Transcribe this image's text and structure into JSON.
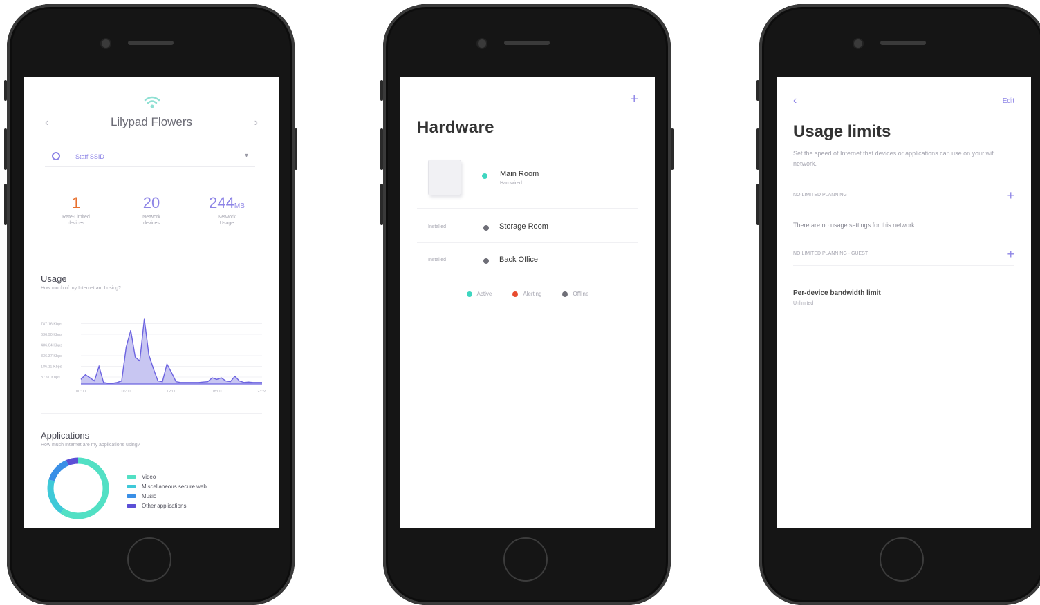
{
  "colors": {
    "accent": "#7b6ee6",
    "orange": "#e8712f",
    "teal": "#3ed6c0",
    "chart_fill": "#c8c6f2",
    "chart_line": "#6c63e0",
    "offline": "#6f6f78",
    "alerting": "#e84c2f"
  },
  "screen1": {
    "title": "Lilypad Flowers",
    "prev_icon": "chevron-left-icon",
    "next_icon": "chevron-right-icon",
    "network_select": {
      "value": "Staff SSID"
    },
    "stats": [
      {
        "value": "1",
        "unit": "",
        "label_line1": "Rate-Limited",
        "label_line2": "devices",
        "color": "#e8712f"
      },
      {
        "value": "20",
        "unit": "",
        "label_line1": "Network",
        "label_line2": "devices",
        "color": "#8d84e6"
      },
      {
        "value": "244",
        "unit": "MB",
        "label_line1": "Network",
        "label_line2": "Usage",
        "color": "#8d84e6"
      }
    ],
    "usage": {
      "title": "Usage",
      "subtitle": "How much of my Internet am I using?"
    },
    "applications": {
      "title": "Applications",
      "subtitle": "How much Internet are my applications using?",
      "legend": [
        {
          "label": "Video",
          "color": "#52e0c4"
        },
        {
          "label": "Miscellaneous secure web",
          "color": "#3fc9d8"
        },
        {
          "label": "Music",
          "color": "#3a8fe6"
        },
        {
          "label": "Other applications",
          "color": "#5b4fd6"
        }
      ]
    }
  },
  "chart_data": {
    "type": "area",
    "title": "",
    "xlabel": "",
    "ylabel": "",
    "y_tick_labels": [
      "37.90 Kbps",
      "186.11 Kbps",
      "336.37 Kbps",
      "486.64 Kbps",
      "636.90 Kbps",
      "787.16 Kbps"
    ],
    "x_tick_labels": [
      "00:00",
      "06:00",
      "12:00",
      "18:00",
      "23:59"
    ],
    "ylim": [
      0,
      900
    ],
    "x": [
      0,
      1,
      2,
      3,
      4,
      5,
      6,
      7,
      8,
      9,
      10,
      11,
      12,
      13,
      14,
      15,
      16,
      17,
      18,
      19,
      20,
      21,
      22,
      23,
      24,
      25,
      26,
      27,
      28,
      29,
      30,
      31,
      32,
      33,
      34,
      35,
      36,
      37,
      38,
      39,
      40
    ],
    "series": [
      {
        "values": [
          60,
          120,
          80,
          40,
          230,
          20,
          10,
          10,
          20,
          40,
          480,
          700,
          350,
          300,
          850,
          380,
          200,
          40,
          30,
          260,
          150,
          30,
          20,
          20,
          20,
          20,
          20,
          25,
          30,
          80,
          60,
          80,
          40,
          30,
          100,
          40,
          20,
          25,
          20,
          20,
          20
        ]
      }
    ]
  },
  "screen2": {
    "title": "Hardware",
    "add_icon": "plus-icon",
    "devices": [
      {
        "name": "Main Room",
        "sub": "Hardwired",
        "status_color": "#3ed6c0",
        "prefix": ""
      },
      {
        "name": "Storage Room",
        "sub": "",
        "status_color": "#6f6f78",
        "prefix": "Installed"
      },
      {
        "name": "Back Office",
        "sub": "",
        "status_color": "#6f6f78",
        "prefix": "Installed"
      }
    ],
    "status_legend": [
      {
        "label": "Active",
        "color": "#3ed6c0"
      },
      {
        "label": "Alerting",
        "color": "#e84c2f"
      },
      {
        "label": "Offline",
        "color": "#6f6f78"
      }
    ]
  },
  "screen3": {
    "back_icon": "chevron-left-icon",
    "edit_label": "Edit",
    "title": "Usage limits",
    "description": "Set the speed of Internet that devices or applications can use on your wifi network.",
    "rows": [
      {
        "label": "NO LIMITED PLANNING",
        "add_icon": "plus-icon"
      },
      {
        "label": "NO LIMITED PLANNING - GUEST",
        "add_icon": "plus-icon"
      }
    ],
    "empty_text": "There are no usage settings for this network.",
    "bandwidth_title": "Per-device bandwidth limit",
    "bandwidth_sub": "Unlimited"
  }
}
